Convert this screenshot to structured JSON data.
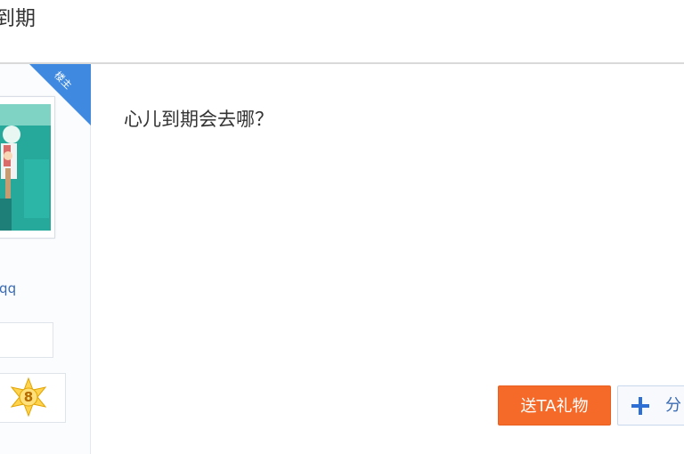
{
  "header": {
    "title": "到期"
  },
  "author": {
    "op_badge": "楼主",
    "name": "/qq",
    "badge_level": "8",
    "badge_icon": "star-badge-icon"
  },
  "post": {
    "content": "心儿到期会去哪？"
  },
  "actions": {
    "gift_label": "送TA礼物",
    "share_label": "分",
    "share_icon": "plus-icon"
  },
  "colors": {
    "accent_orange": "#f56a29",
    "link_blue": "#3a6bb5",
    "ribbon_blue": "#3f8ae0",
    "plus_blue": "#2e6fd6"
  }
}
